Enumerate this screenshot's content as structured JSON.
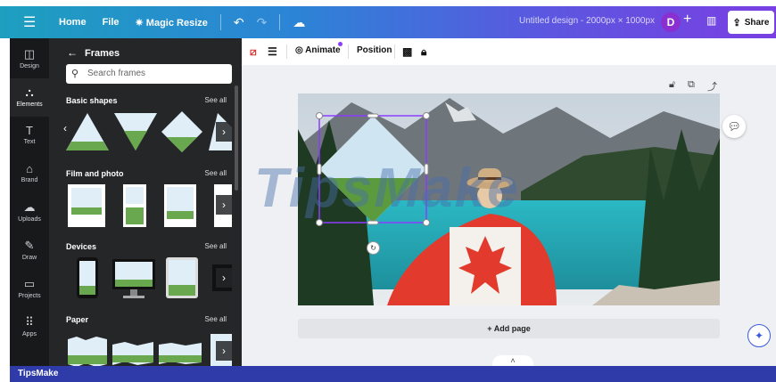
{
  "topbar": {
    "home": "Home",
    "file": "File",
    "magic_resize": "Magic Resize",
    "design_title": "Untitled design - 2000px × 1000px",
    "avatar_letter": "D",
    "share": "Share"
  },
  "rail": {
    "items": [
      {
        "label": "Design",
        "icon": "layout-icon",
        "glyph": "◫"
      },
      {
        "label": "Elements",
        "icon": "shapes-icon",
        "glyph": "⛬"
      },
      {
        "label": "Text",
        "icon": "text-icon",
        "glyph": "T"
      },
      {
        "label": "Brand",
        "icon": "brand-icon",
        "glyph": "⌂"
      },
      {
        "label": "Uploads",
        "icon": "cloud-upload-icon",
        "glyph": "☁"
      },
      {
        "label": "Draw",
        "icon": "pen-icon",
        "glyph": "✎"
      },
      {
        "label": "Projects",
        "icon": "folder-icon",
        "glyph": "▭"
      },
      {
        "label": "Apps",
        "icon": "apps-grid-icon",
        "glyph": "⠿"
      }
    ]
  },
  "panel": {
    "title": "Frames",
    "search_placeholder": "Search frames",
    "sections": [
      {
        "title": "Basic shapes",
        "see_all": "See all"
      },
      {
        "title": "Film and photo",
        "see_all": "See all"
      },
      {
        "title": "Devices",
        "see_all": "See all"
      },
      {
        "title": "Paper",
        "see_all": "See all"
      }
    ]
  },
  "toolbar": {
    "animate": "Animate",
    "position": "Position"
  },
  "canvas": {
    "add_page": "+ Add page",
    "watermark": "TipsMake"
  },
  "footer": {
    "brand": "TipsMake"
  },
  "colors": {
    "accent": "#8b3dff",
    "panel_bg": "#252628",
    "rail_bg": "#18191b",
    "bottom_bar": "#2e3ba8"
  }
}
